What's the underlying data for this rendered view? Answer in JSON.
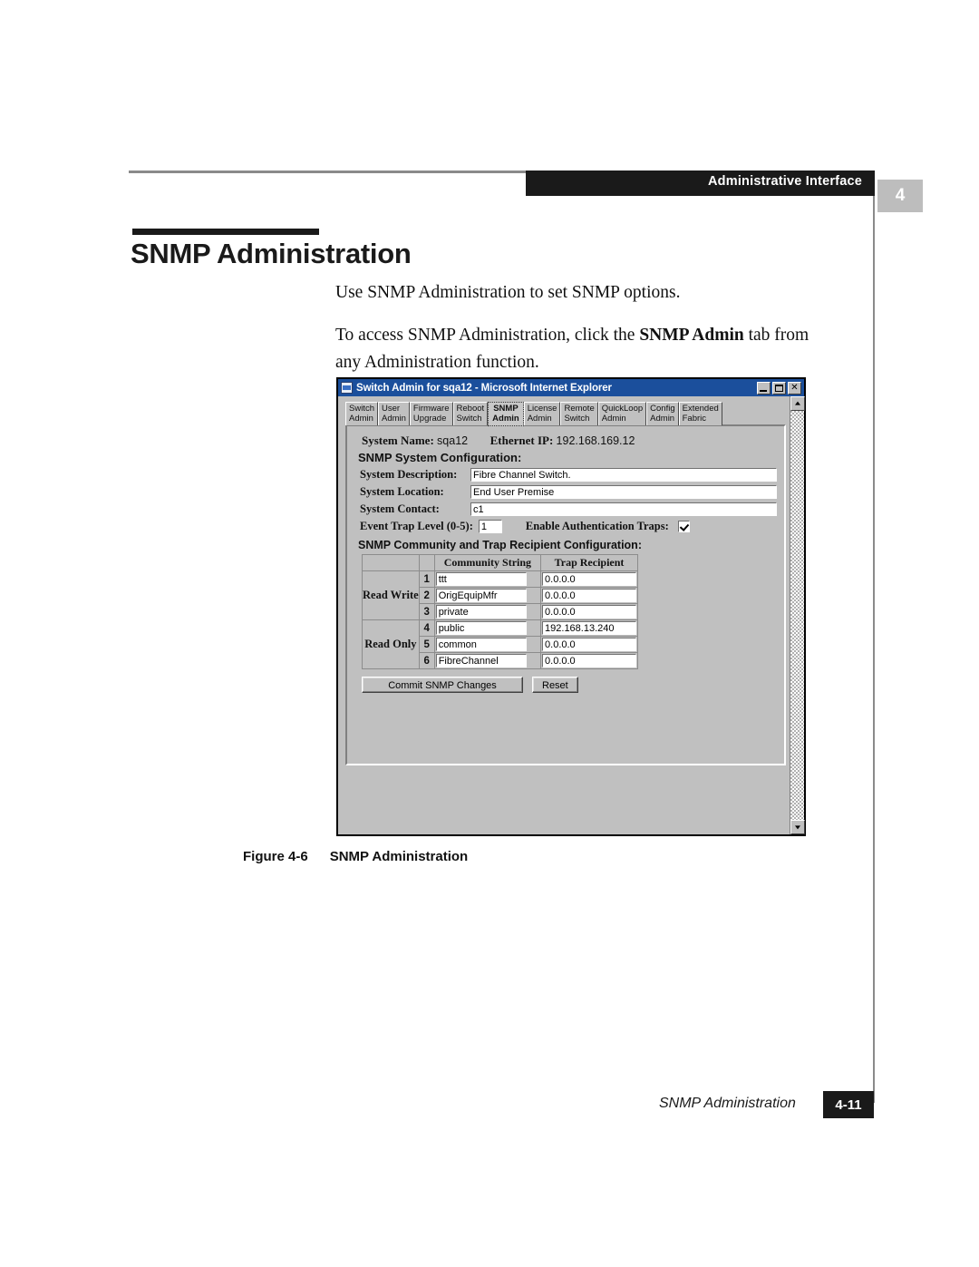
{
  "document": {
    "running_head": "Administrative Interface",
    "chapter_badge": "4",
    "heading": "SNMP Administration",
    "paragraph_1": "Use SNMP Administration to set SNMP options.",
    "paragraph_2_part1": "To access SNMP Administration, click the ",
    "paragraph_2_bold": "SNMP Admin",
    "paragraph_2_part2": " tab from any Administration function.",
    "figure_number": "Figure 4-6",
    "figure_title": "SNMP Administration",
    "footer_title": "SNMP Administration",
    "footer_page": "4-11"
  },
  "browser": {
    "title": "Switch Admin for sqa12 - Microsoft Internet Explorer",
    "minimize_label": "_",
    "maximize_label": "",
    "close_label": "✕",
    "scroll_up_label": "",
    "scroll_down_label": ""
  },
  "tabs": [
    {
      "line1": "Switch",
      "line2": "Admin",
      "active": false
    },
    {
      "line1": "User",
      "line2": "Admin",
      "active": false
    },
    {
      "line1": "Firmware",
      "line2": "Upgrade",
      "active": false
    },
    {
      "line1": "Reboot",
      "line2": "Switch",
      "active": false
    },
    {
      "line1": "SNMP",
      "line2": "Admin",
      "active": true
    },
    {
      "line1": "License",
      "line2": "Admin",
      "active": false
    },
    {
      "line1": "Remote",
      "line2": "Switch",
      "active": false
    },
    {
      "line1": "QuickLoop",
      "line2": "Admin",
      "active": false
    },
    {
      "line1": "Config",
      "line2": "Admin",
      "active": false
    },
    {
      "line1": "Extended",
      "line2": "Fabric",
      "active": false
    }
  ],
  "panel": {
    "system_name_label": "System Name:",
    "system_name_value": "sqa12",
    "ethernet_ip_label": "Ethernet IP:",
    "ethernet_ip_value": "192.168.169.12",
    "system_config_heading": "SNMP System Configuration:",
    "fields": [
      {
        "label": "System Description:",
        "value": "Fibre Channel Switch."
      },
      {
        "label": "System Location:",
        "value": "End User Premise"
      },
      {
        "label": "System Contact:",
        "value": "c1"
      }
    ],
    "event_trap_label": "Event Trap Level (0-5):",
    "event_trap_value": "1",
    "auth_traps_label": "Enable Authentication Traps:",
    "auth_traps_checked": true,
    "community_heading": "SNMP Community and Trap Recipient Configuration:",
    "table": {
      "col_community": "Community String",
      "col_trap": "Trap Recipient",
      "group_read_write": "Read Write",
      "group_read_only": "Read Only",
      "rows": [
        {
          "index": "1",
          "community": "ttt",
          "trap": "0.0.0.0"
        },
        {
          "index": "2",
          "community": "OrigEquipMfr",
          "trap": "0.0.0.0"
        },
        {
          "index": "3",
          "community": "private",
          "trap": "0.0.0.0"
        },
        {
          "index": "4",
          "community": "public",
          "trap": "192.168.13.240"
        },
        {
          "index": "5",
          "community": "common",
          "trap": "0.0.0.0"
        },
        {
          "index": "6",
          "community": "FibreChannel",
          "trap": "0.0.0.0"
        }
      ]
    },
    "commit_button": "Commit SNMP Changes",
    "reset_button": "Reset"
  },
  "colors": {
    "header_bar": "#1a1a1a",
    "chapter_badge": "#bdbdbd",
    "titlebar": "#1b4f9c",
    "window_face": "#c0c0c0"
  }
}
